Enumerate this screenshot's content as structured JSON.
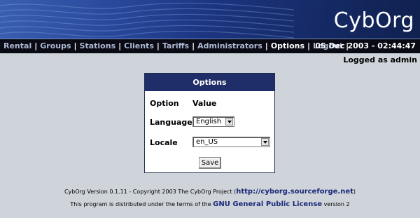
{
  "header": {
    "logo": "CybOrg"
  },
  "nav": {
    "items": [
      "Rental",
      "Groups",
      "Stations",
      "Clients",
      "Tariffs",
      "Administrators",
      "Options",
      "Logout"
    ],
    "active": "Options",
    "separator": "|",
    "datetime": "05 Dec 2003 - 02:44:47"
  },
  "status": {
    "logged_as": "Logged as admin"
  },
  "options_panel": {
    "title": "Options",
    "col_option": "Option",
    "col_value": "Value",
    "language_label": "Language",
    "language_value": "English",
    "locale_label": "Locale",
    "locale_value": "en_US",
    "save_label": "Save"
  },
  "footer": {
    "line1_prefix": "CybOrg Version 0.1.11 - Copyright 2003 The CybOrg Project (",
    "line1_link": "http://cyborg.sourceforge.net",
    "line1_suffix": ")",
    "line2_prefix": "This program is distributed under the terms of the ",
    "line2_link": "GNU General Public License",
    "line2_suffix": " version 2"
  },
  "colors": {
    "header_blue": "#1c3580",
    "navbar": "#0a0a14",
    "panel_title": "#1f2d68",
    "background": "#cfd4da"
  }
}
